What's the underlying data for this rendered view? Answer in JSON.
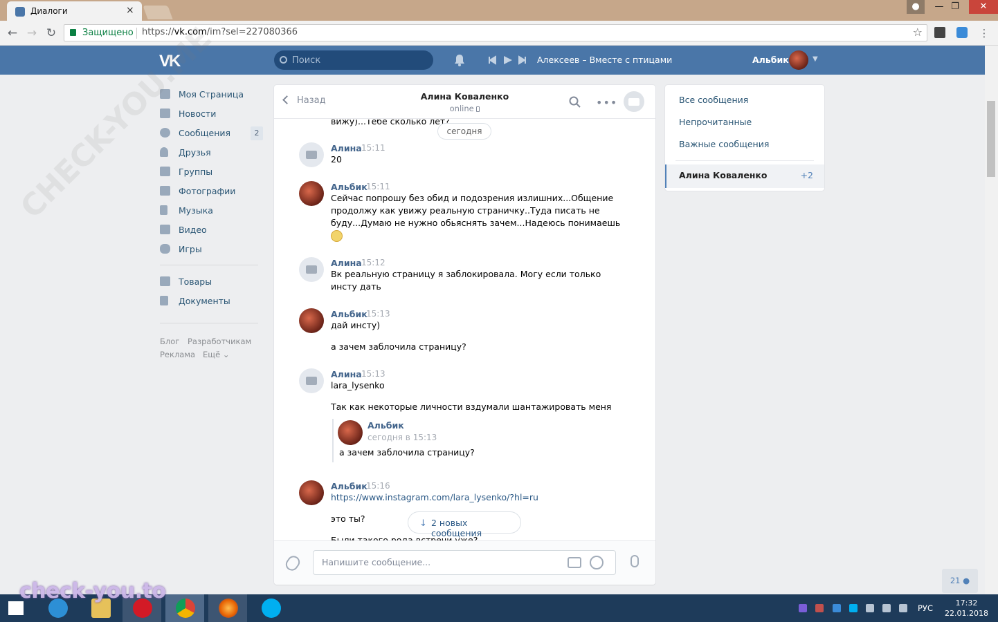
{
  "browser": {
    "tab_title": "Диалоги",
    "security_label": "Защищено",
    "url_scheme": "https://",
    "url_host": "vk.com",
    "url_path": "/im?sel=227080366",
    "window_buttons": [
      "—",
      "❐",
      "✕"
    ]
  },
  "header": {
    "logo": "VK",
    "search_placeholder": "Поиск",
    "now_playing": "Алексеев – Вместе с птицами",
    "user_name": "Альбик"
  },
  "sidebar": {
    "items": [
      {
        "label": "Моя Страница",
        "icon": "home-icon"
      },
      {
        "label": "Новости",
        "icon": "news-icon"
      },
      {
        "label": "Сообщения",
        "icon": "messages-icon",
        "badge": "2"
      },
      {
        "label": "Друзья",
        "icon": "friends-icon"
      },
      {
        "label": "Группы",
        "icon": "groups-icon"
      },
      {
        "label": "Фотографии",
        "icon": "photos-icon"
      },
      {
        "label": "Музыка",
        "icon": "music-icon"
      },
      {
        "label": "Видео",
        "icon": "video-icon"
      },
      {
        "label": "Игры",
        "icon": "games-icon"
      }
    ],
    "items2": [
      {
        "label": "Товары",
        "icon": "market-icon"
      },
      {
        "label": "Документы",
        "icon": "docs-icon"
      }
    ],
    "footer": [
      "Блог",
      "Разработчикам",
      "Реклама",
      "Ещё ⌄"
    ]
  },
  "chat": {
    "back_label": "Назад",
    "peer_name": "Алина Коваленко",
    "peer_status": "online",
    "prev_text": "вижу)...Тебе сколько лет?",
    "date_pill": "сегодня",
    "messages": [
      {
        "author": "Алина",
        "time": "15:11",
        "lines": [
          "20"
        ]
      },
      {
        "author": "Альбик",
        "time": "15:11",
        "lines": [
          "Сейчас попрошу без обид и подозрения излишних...Общение",
          "продолжу как увижу реальную страничку..Туда писать не",
          "буду...Думаю не нужно обьяснять зачем...Надеюсь понимаешь"
        ]
      },
      {
        "author": "Алина",
        "time": "15:12",
        "lines": [
          "Вк реальную страницу я заблокировала. Могу если только",
          "инсту дать"
        ]
      },
      {
        "author": "Альбик",
        "time": "15:13",
        "lines": [
          "дай инсту)",
          "а зачем заблочила страницу?"
        ]
      },
      {
        "author": "Алина",
        "time": "15:13",
        "lines": [
          "lara_lysenko",
          "Так как некоторые личности вздумали шантажировать меня"
        ]
      },
      {
        "author": "Альбик",
        "time": "15:16",
        "lines": [
          "https://www.instagram.com/lara_lysenko/?hl=ru",
          "это ты?",
          "Были такого рода встречи уже?"
        ]
      }
    ],
    "quote": {
      "author": "Альбик",
      "time": "сегодня в 15:13",
      "text": "а зачем заблочила страницу?"
    },
    "new_messages_label": "2 новых сообщения",
    "composer_placeholder": "Напишите сообщение..."
  },
  "right_panel": {
    "filters": [
      "Все сообщения",
      "Непрочитанные",
      "Важные сообщения"
    ],
    "active_dialog": "Алина Коваленко",
    "active_count": "+2"
  },
  "online_count": "21",
  "taskbar": {
    "language": "РУС",
    "time": "17:32",
    "date": "22.01.2018"
  },
  "watermark": "check-you.to",
  "watermark_diag": "CHECK-YOU.ME"
}
